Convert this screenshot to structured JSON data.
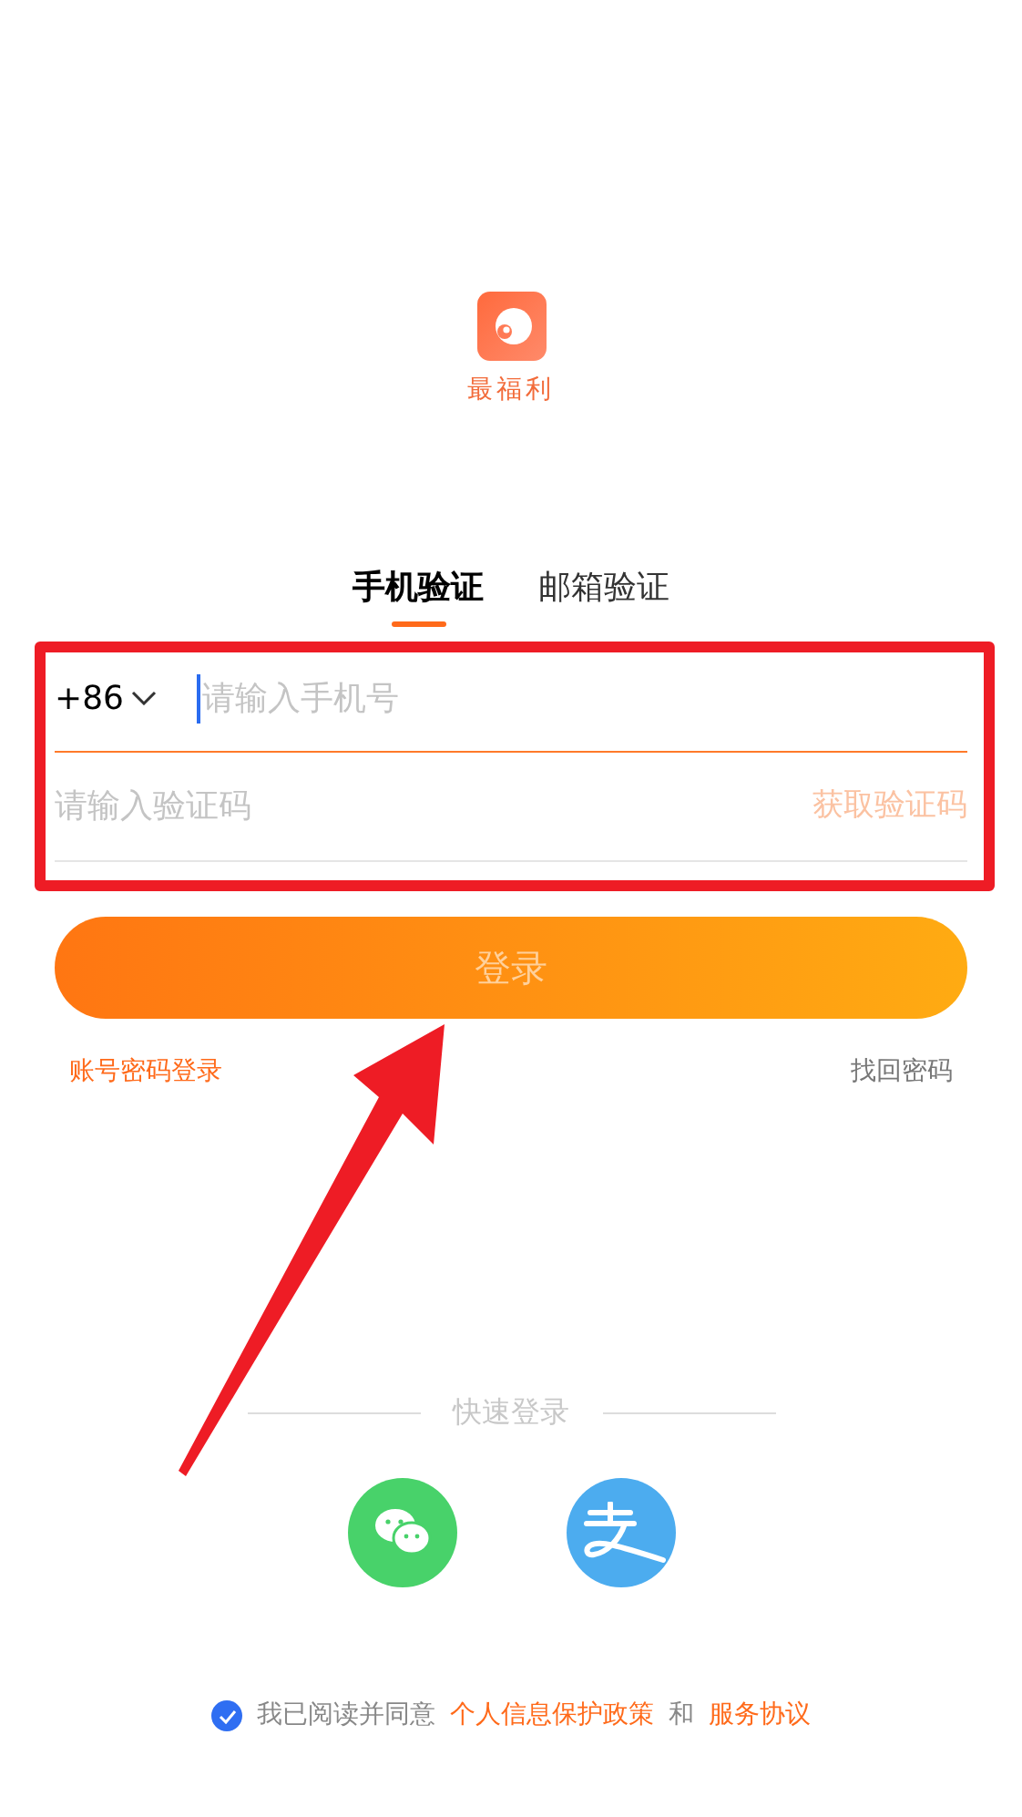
{
  "app": {
    "name": "最福利"
  },
  "tabs": [
    {
      "label": "手机验证",
      "selected": true
    },
    {
      "label": "邮箱验证",
      "selected": false
    }
  ],
  "phone": {
    "country_code": "+86",
    "placeholder": "请输入手机号"
  },
  "code": {
    "placeholder": "请输入验证码",
    "get_code": "获取验证码"
  },
  "login_button": "登录",
  "links": {
    "account_login": "账号密码登录",
    "recover_password": "找回密码"
  },
  "quick_login": {
    "title": "快速登录"
  },
  "agreement": {
    "checked": true,
    "text": "我已阅读并同意",
    "privacy": "个人信息保护政策",
    "and": "和",
    "terms": "服务协议"
  }
}
